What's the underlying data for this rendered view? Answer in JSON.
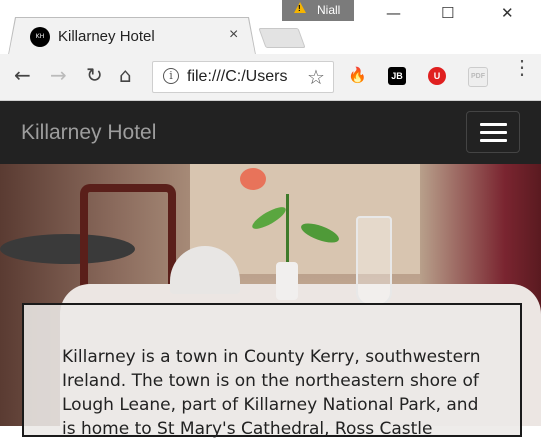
{
  "browser": {
    "tab": {
      "title": "Killarney Hotel",
      "favicon_text": "KH",
      "close": "×"
    },
    "profile": {
      "name": "Niall",
      "warning_mark": "!"
    },
    "window_controls": {
      "minimize": "—",
      "maximize": "☐",
      "close": "✕"
    },
    "nav": {
      "back": "←",
      "forward": "→",
      "reload": "↻",
      "home": "⌂"
    },
    "omnibox": {
      "info": "i",
      "url": "file:///C:/Users",
      "star": "☆"
    },
    "extensions": [
      {
        "name": "flame-extension",
        "glyph": "🔥",
        "color": "#e25b1c"
      },
      {
        "name": "jetbrains-extension",
        "glyph": "JB",
        "color": "#000000"
      },
      {
        "name": "ublock-extension",
        "glyph": "U",
        "color": "#e02020"
      },
      {
        "name": "pdf-extension",
        "glyph": "PDF",
        "color": "#cccccc"
      }
    ],
    "menu": "⋮"
  },
  "page": {
    "navbar": {
      "brand": "Killarney Hotel",
      "background": "#222222"
    },
    "hero": {
      "description": "Killarney is a town in County Kerry, southwestern Ireland. The town is on the northeastern shore of Lough Leane, part of Killarney National Park, and is home to St Mary's Cathedral, Ross Castle"
    }
  }
}
